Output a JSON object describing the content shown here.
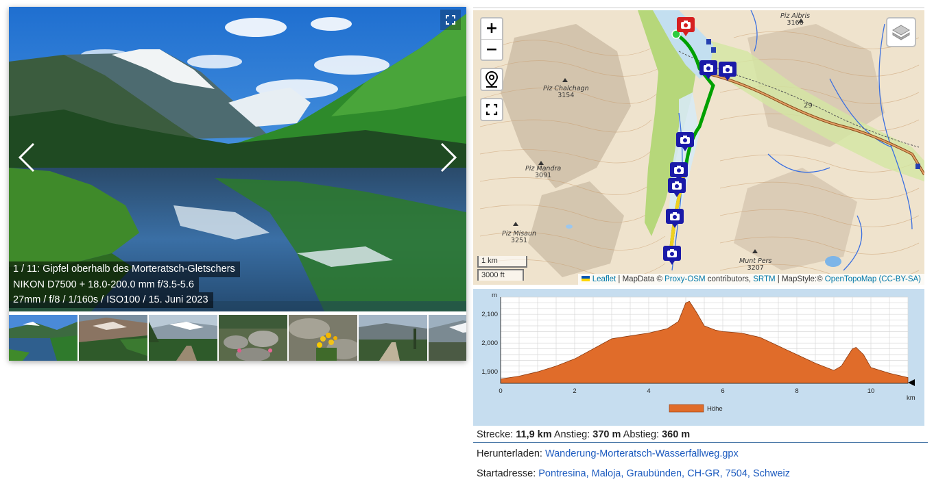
{
  "gallery": {
    "caption": {
      "line1": "1 / 11: Gipfel oberhalb des Morteratsch-Gletschers",
      "line2": "NIKON D7500 + 18.0-200.0 mm f/3.5-5.6",
      "line3": "27mm / f/8 / 1/160s / ISO100 / 15. Juni 2023"
    },
    "icons": {
      "prev": "chevron-left-icon",
      "next": "chevron-right-icon",
      "fullscreen": "expand-icon"
    },
    "thumbnails": [
      "lake-reflection",
      "mountain-valley",
      "forest-trail-glacier",
      "rock-garden",
      "yellow-flowers",
      "valley-path",
      "glacier-moraine"
    ]
  },
  "map": {
    "zoom_in": "+",
    "zoom_out": "−",
    "scale_km": "1 km",
    "scale_ft": "3000 ft",
    "peaks": [
      {
        "name": "Piz Albris",
        "elev": "3166"
      },
      {
        "name": "Piz Chalchagn",
        "elev": "3154"
      },
      {
        "name": "Piz Mandra",
        "elev": "3091"
      },
      {
        "name": "Piz Misaun",
        "elev": "3251"
      },
      {
        "name": "Munt Pers",
        "elev": "3207"
      }
    ],
    "road_label": "29",
    "attribution": {
      "leaflet": "Leaflet",
      "sep1": " | MapData © ",
      "proxy": "Proxy-OSM",
      "contrib": " contributors, ",
      "srtm": "SRTM",
      "style": " | MapStyle:© ",
      "otm": "OpenTopoMap",
      "license": "(CC-BY-SA)"
    },
    "colors": {
      "route": "#00b000",
      "marker": "#1a1aa8",
      "start_marker": "#d62020",
      "terrain": "#efe3cd",
      "forest": "#b6d77a"
    }
  },
  "profile": {
    "y_unit": "m",
    "x_unit": "km",
    "y_ticks": [
      "2,100",
      "2,000",
      "1,900"
    ],
    "x_ticks": [
      "0",
      "2",
      "4",
      "6",
      "8",
      "10"
    ],
    "legend": "Höhe",
    "fill_color": "#e06c2a"
  },
  "chart_data": {
    "type": "area",
    "title": "",
    "xlabel": "km",
    "ylabel": "m",
    "xlim": [
      0,
      11
    ],
    "ylim": [
      1860,
      2160
    ],
    "series": [
      {
        "name": "Höhe",
        "x": [
          0,
          0.5,
          1,
          1.5,
          2,
          2.5,
          3,
          3.5,
          4,
          4.5,
          4.8,
          5.0,
          5.1,
          5.3,
          5.5,
          5.8,
          6.0,
          6.5,
          7.0,
          7.5,
          8.0,
          8.5,
          9.0,
          9.2,
          9.5,
          9.6,
          9.8,
          10.0,
          10.5,
          11.0
        ],
        "y": [
          1875,
          1885,
          1900,
          1920,
          1945,
          1980,
          2015,
          2025,
          2035,
          2050,
          2075,
          2140,
          2145,
          2105,
          2060,
          2045,
          2040,
          2035,
          2020,
          1990,
          1960,
          1930,
          1905,
          1920,
          1980,
          1985,
          1960,
          1915,
          1895,
          1880
        ]
      }
    ]
  },
  "info": {
    "strecke_label": "Strecke: ",
    "strecke_value": "11,9 km",
    "anstieg_label": " Anstieg: ",
    "anstieg_value": "370 m",
    "abstieg_label": " Abstieg: ",
    "abstieg_value": "360 m",
    "download_label": "Herunterladen: ",
    "download_link": "Wanderung-Morteratsch-Wasserfallweg.gpx",
    "start_label": "Startadresse: ",
    "start_link": "Pontresina, Maloja, Graubünden, CH-GR, 7504, Schweiz"
  }
}
